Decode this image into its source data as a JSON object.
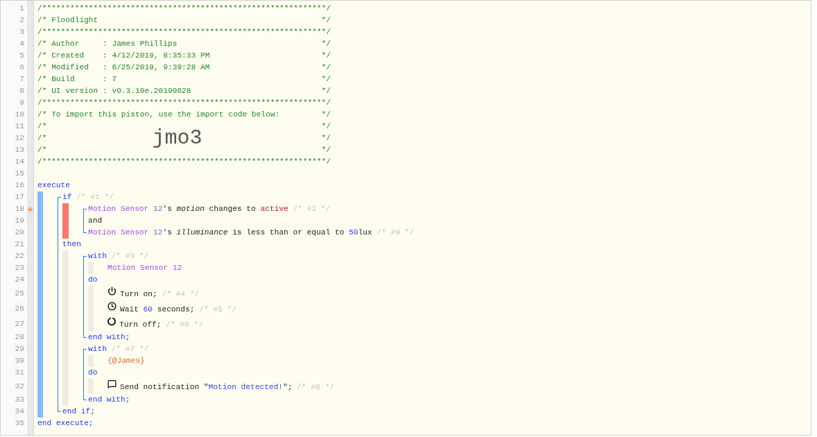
{
  "editor": {
    "header": [
      {
        "number": "1",
        "text": "/*************************************************************/"
      },
      {
        "number": "2",
        "text": "/* Floodlight",
        "end": "*/"
      },
      {
        "number": "3",
        "text": "/*************************************************************/"
      },
      {
        "number": "4",
        "text": "/* Author     : James Phillips",
        "end": "*/"
      },
      {
        "number": "5",
        "text": "/* Created    : 4/12/2019, 8:35:33 PM",
        "end": "*/"
      },
      {
        "number": "6",
        "text": "/* Modified   : 6/25/2019, 9:39:28 AM",
        "end": "*/"
      },
      {
        "number": "7",
        "text": "/* Build      : 7",
        "end": "*/"
      },
      {
        "number": "8",
        "text": "/* UI version : v0.3.10e.20190628",
        "end": "*/"
      },
      {
        "number": "9",
        "text": "/*************************************************************/"
      },
      {
        "number": "10",
        "text": "/* To import this piston, use the import code below:",
        "end": "*/"
      },
      {
        "number": "11",
        "text": "/*",
        "end": "*/"
      },
      {
        "number": "12",
        "text": "/*",
        "code": "jmo3",
        "end": "*/"
      },
      {
        "number": "13",
        "text": "/*",
        "end": "*/"
      },
      {
        "number": "14",
        "text": "/*************************************************************/"
      }
    ],
    "blank": {
      "number": "15"
    },
    "execute": {
      "open": {
        "number": "16",
        "tokens": [
          {
            "kind": "keyword",
            "text": "execute"
          }
        ]
      },
      "body": {
        "open": {
          "number": "17",
          "tokens": [
            {
              "kind": "keyword",
              "text": "if"
            },
            {
              "kind": "comment",
              "text": " /* #1 */"
            }
          ]
        },
        "conditions": [
          {
            "number": "18",
            "trigger": true,
            "tokens": [
              {
                "kind": "device",
                "text": "Motion Sensor 12"
              },
              {
                "kind": "text",
                "text": "'s "
              },
              {
                "kind": "attribute",
                "text": "motion"
              },
              {
                "kind": "text",
                "text": " changes to "
              },
              {
                "kind": "value",
                "text": "active"
              },
              {
                "kind": "comment",
                "text": " /* #2 */"
              }
            ]
          },
          {
            "number": "19",
            "trigger": false,
            "tokens": [
              {
                "kind": "text",
                "text": "and"
              }
            ]
          },
          {
            "number": "20",
            "trigger": false,
            "tokens": [
              {
                "kind": "device",
                "text": "Motion Sensor 12"
              },
              {
                "kind": "text",
                "text": "'s "
              },
              {
                "kind": "attribute",
                "text": "illuminance"
              },
              {
                "kind": "text",
                "text": " is less than or equal to "
              },
              {
                "kind": "number",
                "text": "50"
              },
              {
                "kind": "text",
                "text": "lux"
              },
              {
                "kind": "comment",
                "text": " /* #9 */"
              }
            ]
          }
        ],
        "then": {
          "number": "21",
          "tokens": [
            {
              "kind": "keyword",
              "text": "then"
            }
          ]
        },
        "actions": [
          {
            "open": {
              "number": "22",
              "tokens": [
                {
                  "kind": "keyword",
                  "text": "with"
                },
                {
                  "kind": "comment",
                  "text": " /* #3 */"
                }
              ]
            },
            "devices": [
              {
                "number": "23",
                "tokens": [
                  {
                    "kind": "device",
                    "text": "Motion Sensor 12"
                  }
                ]
              }
            ],
            "do": {
              "number": "24",
              "tokens": [
                {
                  "kind": "keyword",
                  "text": "do"
                }
              ]
            },
            "statements": [
              {
                "number": "25",
                "kind": "turn_on",
                "tokens": [
                  {
                    "kind": "text",
                    "text": "Turn on;"
                  },
                  {
                    "kind": "comment",
                    "text": " /* #4 */"
                  }
                ]
              },
              {
                "number": "26",
                "kind": "wait",
                "tokens": [
                  {
                    "kind": "text",
                    "text": "Wait "
                  },
                  {
                    "kind": "number",
                    "text": "60"
                  },
                  {
                    "kind": "text",
                    "text": " seconds;"
                  },
                  {
                    "kind": "comment",
                    "text": " /* #5 */"
                  }
                ]
              },
              {
                "number": "27",
                "kind": "turn_off",
                "tokens": [
                  {
                    "kind": "text",
                    "text": "Turn off;"
                  },
                  {
                    "kind": "comment",
                    "text": " /* #6 */"
                  }
                ]
              }
            ],
            "close": {
              "number": "28",
              "tokens": [
                {
                  "kind": "keyword",
                  "text": "end with;"
                }
              ]
            }
          },
          {
            "open": {
              "number": "29",
              "tokens": [
                {
                  "kind": "keyword",
                  "text": "with"
                },
                {
                  "kind": "comment",
                  "text": " /* #7 */"
                }
              ]
            },
            "devices": [
              {
                "number": "30",
                "tokens": [
                  {
                    "kind": "variable",
                    "text": "{@James}"
                  }
                ]
              }
            ],
            "do": {
              "number": "31",
              "tokens": [
                {
                  "kind": "keyword",
                  "text": "do"
                }
              ]
            },
            "statements": [
              {
                "number": "32",
                "kind": "notify",
                "tokens": [
                  {
                    "kind": "text",
                    "text": "Send notification \""
                  },
                  {
                    "kind": "string",
                    "text": "Motion detected!"
                  },
                  {
                    "kind": "text",
                    "text": "\";"
                  },
                  {
                    "kind": "comment",
                    "text": " /* #8 */"
                  }
                ]
              }
            ],
            "close": {
              "number": "33",
              "tokens": [
                {
                  "kind": "keyword",
                  "text": "end with;"
                }
              ]
            }
          }
        ],
        "close": {
          "number": "34",
          "tokens": [
            {
              "kind": "keyword",
              "text": "end if;"
            }
          ]
        }
      },
      "close": {
        "number": "35",
        "tokens": [
          {
            "kind": "keyword",
            "text": "end execute;"
          }
        ]
      }
    }
  }
}
